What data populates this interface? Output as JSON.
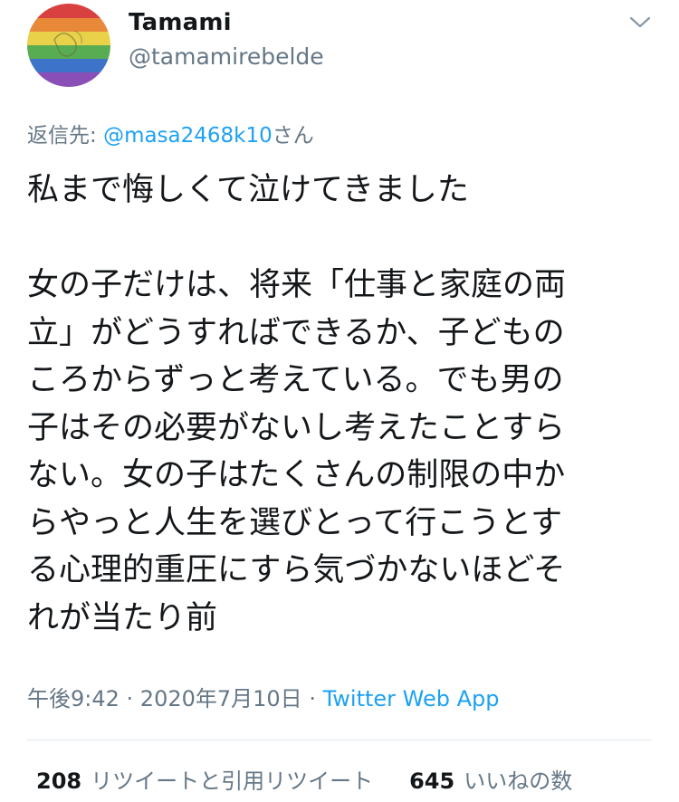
{
  "user": {
    "display_name": "Tamami",
    "handle": "@tamamirebelde",
    "avatar_icon": "rainbow-avatar-icon"
  },
  "menu_icon": "chevron-down-icon",
  "reply": {
    "prefix": "返信先: ",
    "mention": "@masa2468k10",
    "suffix": "さん"
  },
  "tweet": {
    "lines": [
      "私まで悔しくて泣けてきました",
      "",
      "女の子だけは、将来「仕事と家庭の両",
      "立」がどうすればできるか、子どもの",
      "ころからずっと考えている。でも男の",
      "子はその必要がないし考えたことすら",
      "ない。女の子はたくさんの制限の中か",
      "らやっと人生を選びとって行こうとす",
      "る心理的重圧にすら気づかないほどそ",
      "れが当たり前"
    ]
  },
  "meta": {
    "time": "午後9:42",
    "sep1": " · ",
    "date": "2020年7月10日",
    "sep2": " · ",
    "source": "Twitter Web App"
  },
  "stats": {
    "retweets_count": "208",
    "retweets_label": "リツイートと引用リツイート",
    "likes_count": "645",
    "likes_label": "いいねの数"
  },
  "colors": {
    "link": "#1da1f2",
    "secondary_text": "#657786",
    "primary_text": "#14171a",
    "divider": "#e1e8ed"
  }
}
